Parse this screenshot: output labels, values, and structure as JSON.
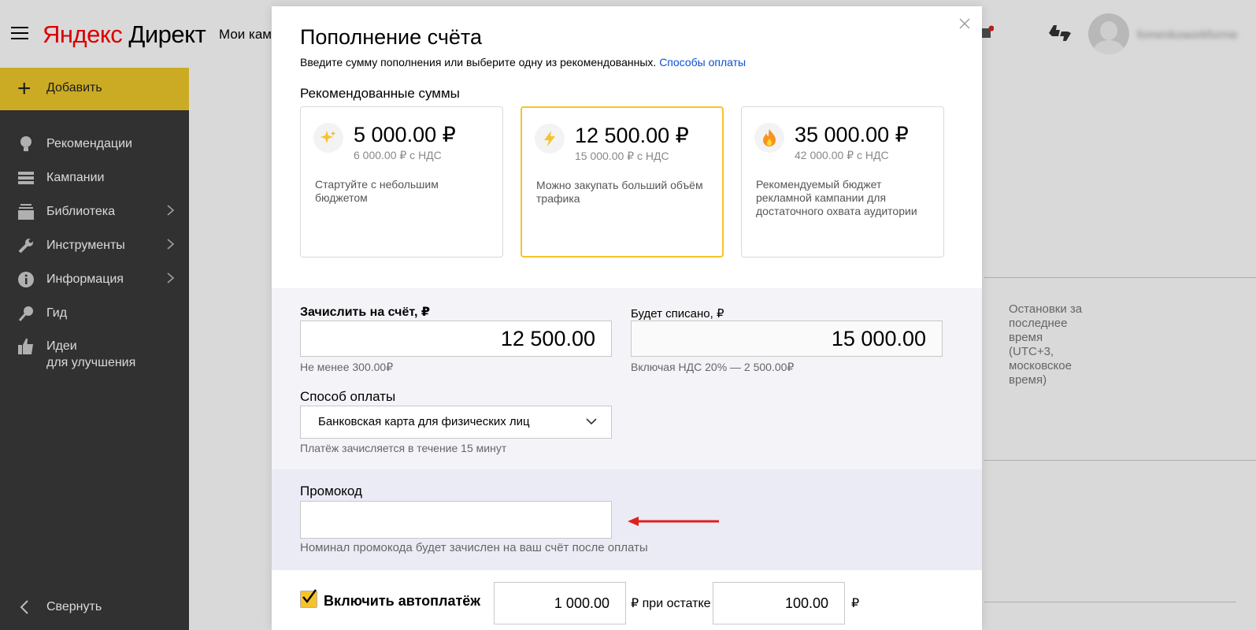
{
  "header": {
    "logo_part1": "Яндекс",
    "logo_part2": "Директ",
    "top_link": "Мои кам",
    "username": "fomenkoworkforme"
  },
  "sidebar": {
    "add_label": "Добавить",
    "items": [
      {
        "label": "Рекомендации",
        "icon": "lightbulb-icon"
      },
      {
        "label": "Кампании",
        "icon": "list-icon"
      },
      {
        "label": "Библиотека",
        "icon": "library-icon"
      },
      {
        "label": "Инструменты",
        "icon": "wrench-icon"
      },
      {
        "label": "Информация",
        "icon": "info-icon"
      },
      {
        "label": "Гид",
        "icon": "guide-icon"
      },
      {
        "label": "Идеи",
        "label2": "для улучшения",
        "icon": "thumbs-up-icon"
      }
    ],
    "collapse_label": "Свернуть"
  },
  "background": {
    "side_text": "Остановки за последнее время (UTC+3, московское время)"
  },
  "modal": {
    "title": "Пополнение счёта",
    "subtitle": "Введите сумму пополнения или выберите одну из рекомендованных.",
    "payment_methods_link": "Способы оплаты",
    "recommended_title": "Рекомендованные суммы",
    "cards": [
      {
        "amount": "5 000.00 ₽",
        "vat": "6 000.00 ₽ с НДС",
        "desc": "Стартуйте с небольшим бюджетом",
        "icon": "sparkle-icon"
      },
      {
        "amount": "12 500.00 ₽",
        "vat": "15 000.00 ₽ с НДС",
        "desc": "Можно закупать больший объём трафика",
        "icon": "lightning-icon"
      },
      {
        "amount": "35 000.00 ₽",
        "vat": "42 000.00 ₽ с НДС",
        "desc": "Рекомендуемый бюджет рекламной кампании для достаточного охвата аудитории",
        "icon": "fire-icon"
      }
    ],
    "credit_label": "Зачислить на счёт, ₽",
    "credit_value": "12 500.00",
    "credit_hint": "Не менее 300.00₽",
    "debit_label": "Будет списано, ₽",
    "debit_value": "15 000.00",
    "debit_hint": "Включая НДС 20% — 2 500.00₽",
    "payment_label": "Способ оплаты",
    "payment_value": "Банковская карта для физических лиц",
    "payment_hint": "Платёж зачисляется в течение 15 минут",
    "promo_label": "Промокод",
    "promo_value": "",
    "promo_hint": "Номинал промокода будет зачислен на ваш счёт после оплаты",
    "autopay_label": "Включить автоплатёж",
    "autopay_checked": true,
    "autopay_amount": "1 000.00",
    "autopay_mid": "₽ при остатке",
    "autopay_threshold": "100.00",
    "autopay_currency": "₽"
  },
  "colors": {
    "sidebar_bg": "#3a3a3a",
    "accent": "#f6c32c",
    "link": "#0a4fd6",
    "arrow": "#e0201b"
  }
}
